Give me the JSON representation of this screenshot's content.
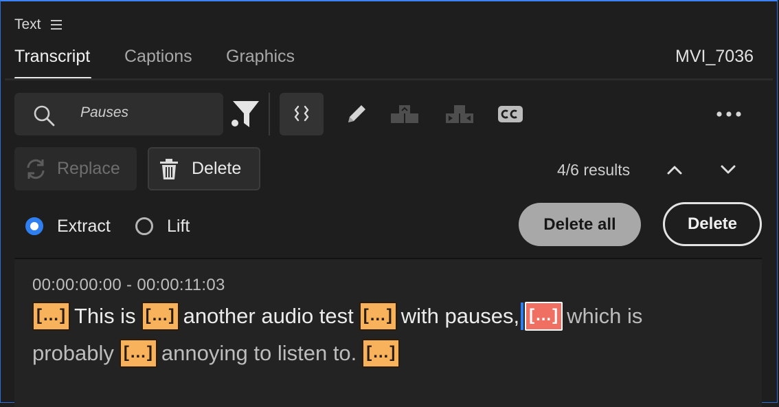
{
  "panel": {
    "title": "Text",
    "menu_icon": "hamburger-menu-icon"
  },
  "tabs": [
    {
      "label": "Transcript",
      "active": true
    },
    {
      "label": "Captions",
      "active": false
    },
    {
      "label": "Graphics",
      "active": false
    }
  ],
  "clip_name": "MVI_7036",
  "toolbar": {
    "search_value": "Pauses",
    "icons": [
      "search-icon",
      "filter-icon",
      "pauses-toggle-icon",
      "pencil-icon",
      "merge-segments-icon",
      "split-segment-icon",
      "closed-captions-icon",
      "more-icon"
    ]
  },
  "actions": {
    "replace_label": "Replace",
    "delete_label": "Delete",
    "results": "4/6 results"
  },
  "mode": {
    "extract_label": "Extract",
    "lift_label": "Lift",
    "selected": "Extract"
  },
  "buttons": {
    "delete_all_label": "Delete all",
    "delete_label": "Delete"
  },
  "transcript": {
    "timecode": "00:00:00:00 - 00:00:11:03",
    "pause_token": "[…]",
    "line1": {
      "text1": "This is",
      "text2": "another audio test",
      "text3": "with pauses,",
      "text4": "which is"
    },
    "line2": {
      "text1": "probably",
      "text2": "annoying to listen to."
    }
  },
  "colors": {
    "accent": "#2f7ff0",
    "pause_highlight": "#f8b25c",
    "current_pause_highlight": "#ef7062",
    "background": "#1e1e1e"
  }
}
